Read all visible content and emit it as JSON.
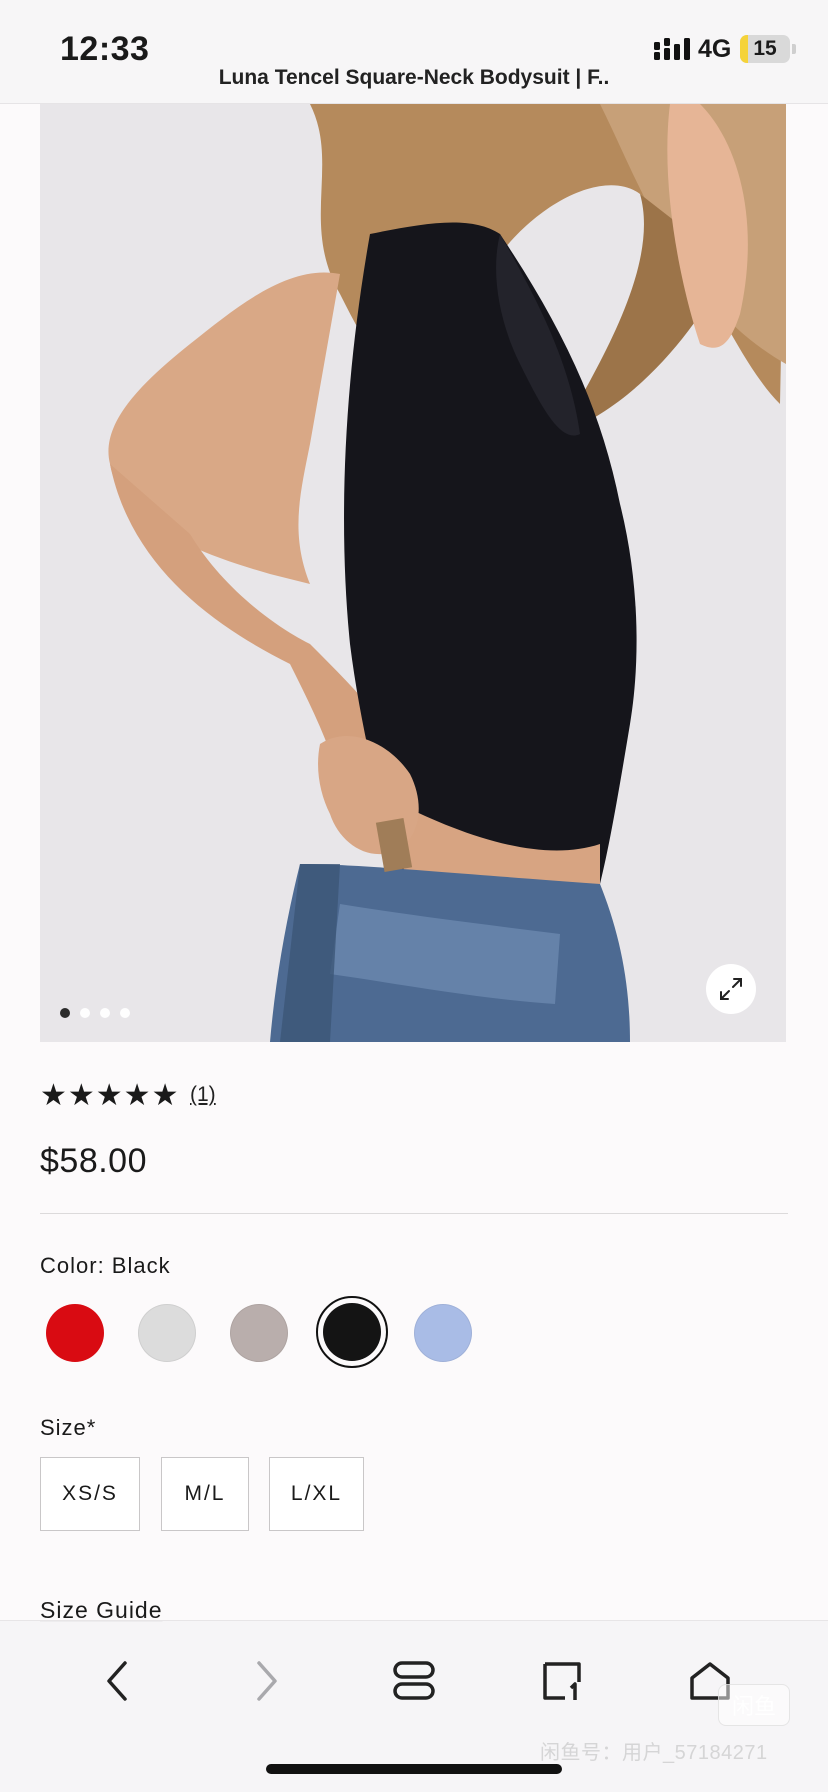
{
  "status_bar": {
    "time": "12:33",
    "network": "4G",
    "battery": "15",
    "battery_level": 0.15
  },
  "page_title": "Luna Tencel Square-Neck Bodysuit | F..",
  "gallery": {
    "image_count": 4,
    "active_index": 0,
    "expand_icon": "expand-arrows-icon"
  },
  "reviews": {
    "stars_text": "★★★★★",
    "rating": 5,
    "count_label": "(1)"
  },
  "price": "$58.00",
  "color": {
    "label": "Color: Black",
    "swatches": [
      {
        "name": "red",
        "hex": "#d90b12",
        "selected": false
      },
      {
        "name": "light-grey",
        "hex": "#dcdcdc",
        "selected": false
      },
      {
        "name": "taupe",
        "hex": "#b9aeac",
        "selected": false
      },
      {
        "name": "black",
        "hex": "#141414",
        "selected": true
      },
      {
        "name": "light-blue",
        "hex": "#a9bce6",
        "selected": false
      }
    ]
  },
  "size": {
    "label": "Size*",
    "options": [
      "XS/S",
      "M/L",
      "L/XL"
    ]
  },
  "size_guide_label": "Size Guide",
  "toolbar": {
    "back_icon": "chevron-left-icon",
    "forward_icon": "chevron-right-icon",
    "tabs_icon": "tabs-icon",
    "bookmarks_icon": "bookmark-icon",
    "home_icon": "home-icon"
  },
  "watermark": {
    "badge": "闲鱼",
    "text": "闲鱼号：用户_57184271"
  }
}
